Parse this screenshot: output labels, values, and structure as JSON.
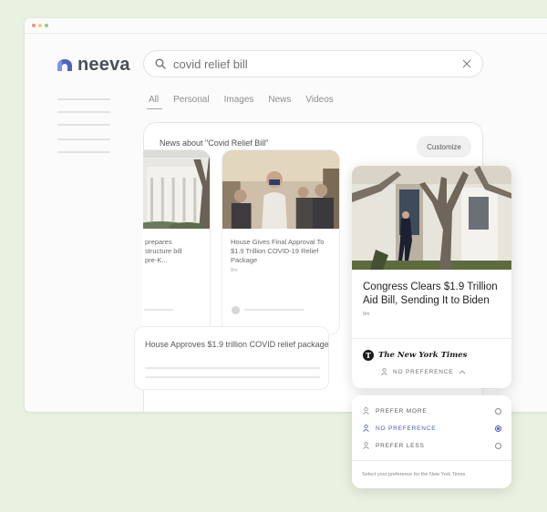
{
  "brand": {
    "name": "neeva",
    "logo_color": "#4f63c4"
  },
  "search": {
    "query": "covid relief bill",
    "icon": "search-icon",
    "clear_icon": "close-icon"
  },
  "tabs": [
    {
      "label": "All",
      "active": true
    },
    {
      "label": "Personal"
    },
    {
      "label": "Images"
    },
    {
      "label": "News"
    },
    {
      "label": "Videos"
    }
  ],
  "news": {
    "heading": "News about \"Covid Relief Bill\"",
    "customize_label": "Customize",
    "cards": [
      {
        "title_lines": [
          "prepares",
          "structure bill",
          "pre-K..."
        ]
      },
      {
        "title": "House Gives Final Approval To $1.9 Trillion COVID-19 Relief Package",
        "time": "8m"
      }
    ],
    "summary": "House Approves $1.9 trillion COVID relief package"
  },
  "feature": {
    "title": "Congress Clears $1.9 Trillion Aid Bill, Sending It to Biden",
    "time": "9m",
    "source_initial": "T",
    "source_name": "The New York Times",
    "preference_label": "NO PREFERENCE"
  },
  "preferences": {
    "options": [
      {
        "label": "PREFER MORE",
        "selected": false
      },
      {
        "label": "NO PREFERENCE",
        "selected": true
      },
      {
        "label": "PREFER LESS",
        "selected": false
      }
    ],
    "note": "Select your preference for the New York Times",
    "accent_color": "#4c56b8"
  }
}
